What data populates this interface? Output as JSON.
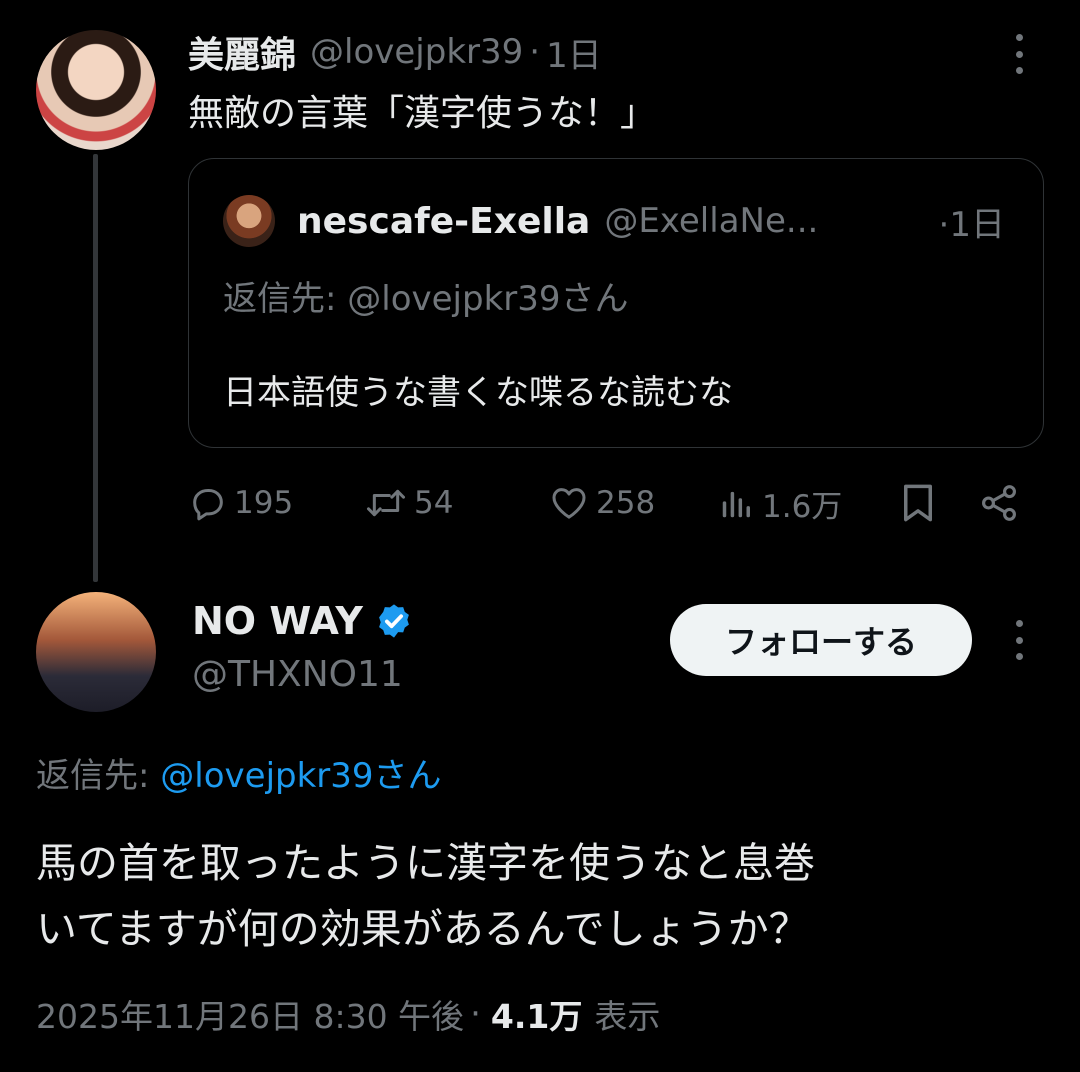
{
  "parent_tweet": {
    "display_name": "美麗錦",
    "handle": "@lovejpkr39",
    "separator": "·",
    "time": "1日",
    "text": "無敵の言葉「漢字使うな！」",
    "quoted": {
      "display_name": "nescafe-Exella",
      "handle": "@ExellaNe...",
      "time": "·1日",
      "reply_to": "返信先: @lovejpkr39さん",
      "text": "日本語使うな書くな喋るな読むな"
    },
    "actions": {
      "replies": "195",
      "retweets": "54",
      "likes": "258",
      "views": "1.6万"
    }
  },
  "reply_tweet": {
    "display_name": "NO WAY",
    "handle": "@THXNO11",
    "follow_label": "フォローする",
    "reply_to_label": "返信先:",
    "reply_to_mention": "@lovejpkr39さん",
    "text_line1": "馬の首を取ったように漢字を使うなと息巻",
    "text_line2": "いてますが何の効果があるんでしょうか？",
    "timestamp": "2025年11月26日 8:30 午後",
    "separator": "·",
    "views_count": "4.1万",
    "views_label": "表示"
  },
  "colors": {
    "background": "#000000",
    "text_primary": "#e7e9ea",
    "text_secondary": "#71767b",
    "accent_blue": "#1d9bf0",
    "border": "#2f3336"
  }
}
